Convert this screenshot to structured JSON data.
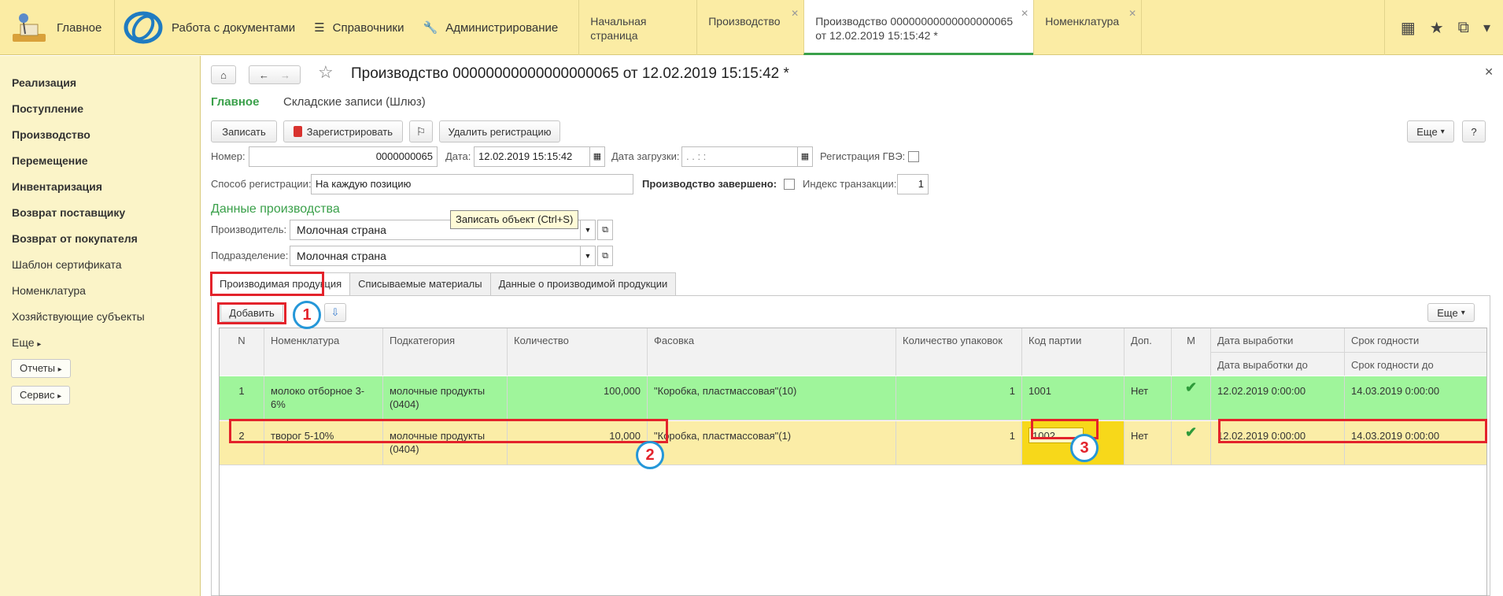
{
  "topbar": {
    "home": "Главное",
    "docs": "Работа с документами",
    "refs": "Справочники",
    "admin": "Администрирование",
    "tabs": [
      "Начальная страница",
      "Производство",
      "Производство 00000000000000000065 от 12.02.2019 15:15:42 *",
      "Номенклатура"
    ]
  },
  "sidebar": {
    "items": [
      "Реализация",
      "Поступление",
      "Производство",
      "Перемещение",
      "Инвентаризация",
      "Возврат поставщику",
      "Возврат от покупателя",
      "Шаблон сертификата",
      "Номенклатура",
      "Хозяйствующие субъекты",
      "Еще"
    ],
    "reports": "Отчеты",
    "service": "Сервис"
  },
  "doc": {
    "title": "Производство 00000000000000000065 от 12.02.2019 15:15:42 *",
    "nav_main": "Главное",
    "nav_records": "Складские записи (Шлюз)",
    "btn_save": "Записать",
    "btn_register": "Зарегистрировать",
    "btn_unregister": "Удалить регистрацию",
    "btn_more": "Еще",
    "btn_help": "?",
    "tooltip": "Записать объект (Ctrl+S)",
    "lbl_number": "Номер:",
    "number_value": "0000000065",
    "lbl_date": "Дата:",
    "date_value": "12.02.2019 15:15:42",
    "lbl_load_date": "Дата загрузки:",
    "load_date_value": ".  .       :  :",
    "lbl_gvz": "Регистрация ГВЭ:",
    "lbl_method": "Способ регистрации:",
    "method_value": "На каждую позицию",
    "lbl_done": "Производство завершено:",
    "lbl_tx": "Индекс транзакции:",
    "tx_value": "1",
    "section": "Данные производства",
    "lbl_producer": "Производитель:",
    "producer_value": "Молочная страна",
    "lbl_division": "Подразделение:",
    "division_value": "Молочная страна"
  },
  "ctabs": [
    "Производимая продукция",
    "Списываемые материалы",
    "Данные о производимой продукции"
  ],
  "table_toolbar": {
    "add": "Добавить",
    "more": "Еще"
  },
  "table": {
    "headers": [
      "N",
      "Номенклатура",
      "Подкатегория",
      "Количество",
      "Фасовка",
      "Количество упаковок",
      "Код партии",
      "Доп.",
      "М",
      "Дата выработки",
      "Срок годности"
    ],
    "subheaders": [
      "Дата выработки до",
      "Срок годности до"
    ],
    "rows": [
      {
        "n": "1",
        "nom": "молоко отборное 3-6%",
        "sub": "молочные продукты (0404)",
        "qty": "100,000",
        "pack": "\"Коробка, пластмассовая\"(10)",
        "packs": "1",
        "code": "1001",
        "dop": "Нет",
        "m": "✔",
        "made": "12.02.2019 0:00:00",
        "exp": "14.03.2019 0:00:00"
      },
      {
        "n": "2",
        "nom": "творог 5-10%",
        "sub": "молочные продукты (0404)",
        "qty": "10,000",
        "pack": "\"Коробка, пластмассовая\"(1)",
        "packs": "1",
        "code": "1002",
        "dop": "Нет",
        "m": "✔",
        "made": "12.02.2019 0:00:00",
        "exp": "14.03.2019 0:00:00"
      }
    ]
  },
  "badges": [
    "1",
    "2",
    "3"
  ],
  "colors": {
    "accent_green": "#3aa04a",
    "row_green": "#9ff59b",
    "row_yellow": "#fbeda7",
    "annotation_red": "#e3232b",
    "annotation_blue": "#2597d8"
  }
}
